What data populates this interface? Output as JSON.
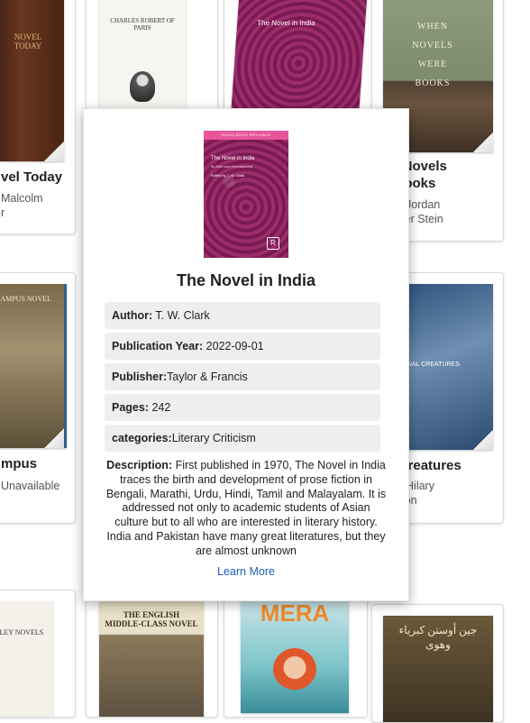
{
  "background_books": [
    {
      "title_lines": [
        "vel Today"
      ],
      "author_lines": [
        "Malcolm",
        "r"
      ],
      "cover_text": "NOVEL TODAY"
    },
    {
      "title_lines": [],
      "author_lines": [],
      "cover_text": "CHARLES ROBERT OF PARIS"
    },
    {
      "title_lines": [],
      "author_lines": [],
      "cover_text": "The Novel in India"
    },
    {
      "title_lines": [
        "en Novels",
        "e Books"
      ],
      "author_lines": [
        "hor: Jordan",
        "lander Stein"
      ],
      "cover_text": "WHEN NOVELS WERE BOOKS"
    },
    {
      "title_lines": [
        "mpus"
      ],
      "author_lines": [
        "",
        "Unavailable"
      ],
      "cover_text": "CAMPUS NOVEL"
    },
    {
      "title_lines": [
        "el Creatures"
      ],
      "author_lines": [
        "hor: Hilary",
        "mpson"
      ],
      "cover_text": "FICTIONAL CREATURES"
    },
    {
      "title_lines": [],
      "author_lines": [],
      "cover_text": "SLEY NOVELS"
    },
    {
      "title_lines": [],
      "author_lines": [],
      "cover_text": "THE ENGLISH MIDDLE-CLASS NOVEL"
    },
    {
      "title_lines": [],
      "author_lines": [],
      "cover_text": "MERA"
    },
    {
      "title_lines": [],
      "author_lines": [],
      "cover_text": "جين أوستن كبرياء وهوى"
    }
  ],
  "modal": {
    "cover_series": "ROUTLEDGE REVIVALS",
    "cover_title": "The Novel in India",
    "cover_subtitle": "Its Birth and Development",
    "cover_editor": "Edited by T. W. Clark",
    "title": "The Novel in India",
    "fields": [
      {
        "label": "Author:",
        "value": " T. W. Clark"
      },
      {
        "label": "Publication Year:",
        "value": " 2022-09-01"
      },
      {
        "label": "Publisher:",
        "value": "Taylor & Francis"
      },
      {
        "label": "Pages:",
        "value": " 242"
      },
      {
        "label": "categories:",
        "value": "Literary Criticism"
      }
    ],
    "description_label": "Description:",
    "description": " First published in 1970, The Novel in India traces the birth and development of prose fiction in Bengali, Marathi, Urdu, Hindi, Tamil and Malayalam. It is addressed not only to academic students of Asian culture but to all who are interested in literary history. India and Pakistan have many great literatures, but they are almost unknown",
    "learn_more": "Learn More"
  },
  "colors": {
    "link": "#1a5fb4",
    "field_bg": "#eeeeee"
  }
}
